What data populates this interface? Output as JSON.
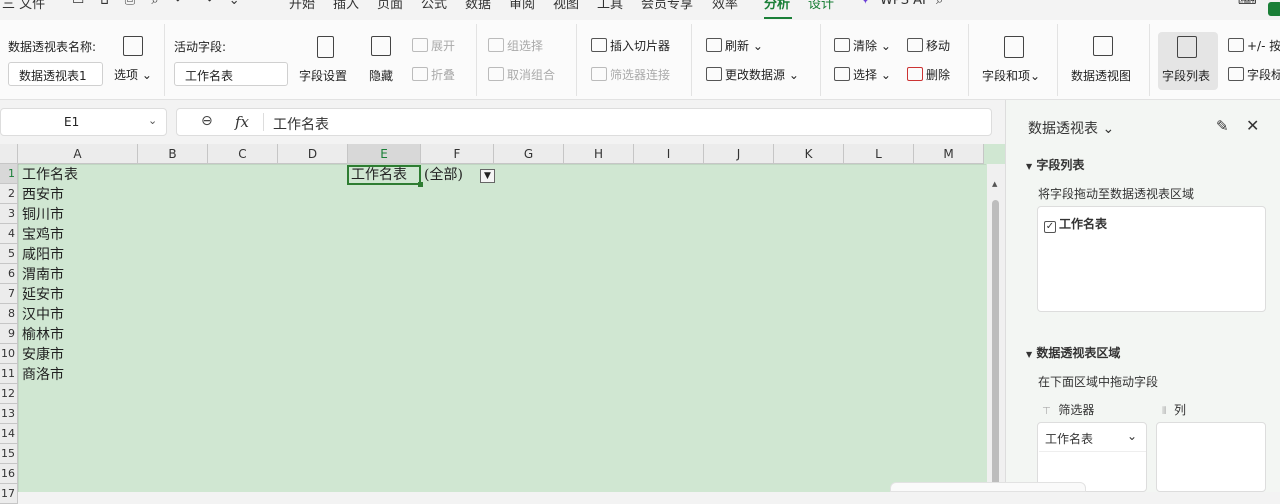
{
  "menu": {
    "tabs": [
      {
        "label": "三 文件"
      },
      {
        "label": "开始"
      },
      {
        "label": "插入"
      },
      {
        "label": "页面"
      },
      {
        "label": "公式"
      },
      {
        "label": "数据"
      },
      {
        "label": "审阅"
      },
      {
        "label": "视图"
      },
      {
        "label": "工具"
      },
      {
        "label": "会员专享"
      },
      {
        "label": "效率"
      },
      {
        "label": "分析"
      },
      {
        "label": "设计"
      },
      {
        "label": "WPS AI"
      }
    ]
  },
  "ribbon": {
    "pivot_name_label": "数据透视表名称:",
    "pivot_name_value": "数据透视表1",
    "options": "选项",
    "active_field_label": "活动字段:",
    "active_field_value": "工作名表",
    "field_settings": "字段设置",
    "hide": "隐藏",
    "expand": "展开",
    "collapse": "折叠",
    "group_select": "组选择",
    "ungroup": "取消组合",
    "insert_slicer": "插入切片器",
    "filter_connection": "筛选器连接",
    "refresh": "刷新",
    "change_source": "更改数据源",
    "clear": "清除",
    "select": "选择",
    "move": "移动",
    "delete": "删除",
    "fields_items": "字段和项",
    "pivot_chart": "数据透视图",
    "field_list": "字段列表",
    "plus_minus": "+/- 按",
    "field_header": "字段标"
  },
  "formula_bar": {
    "cell_ref": "E1",
    "fx": "fx",
    "content": "工作名表"
  },
  "sheet": {
    "columns": [
      "A",
      "B",
      "C",
      "D",
      "E",
      "F",
      "G",
      "H",
      "I",
      "J",
      "K",
      "L",
      "M"
    ],
    "rows": [
      "1",
      "2",
      "3",
      "4",
      "5",
      "6",
      "7",
      "8",
      "9",
      "10",
      "11",
      "12",
      "13",
      "14",
      "15",
      "16",
      "17"
    ],
    "colA": [
      "工作名表",
      "西安市",
      "铜川市",
      "宝鸡市",
      "咸阳市",
      "渭南市",
      "延安市",
      "汉中市",
      "榆林市",
      "安康市",
      "商洛市"
    ],
    "e1": "工作名表",
    "f1": "(全部)"
  },
  "panel": {
    "title": "数据透视表",
    "field_list_header": "字段列表",
    "drag_hint": "将字段拖动至数据透视表区域",
    "field_item": "工作名表",
    "area_header": "数据透视表区域",
    "area_hint": "在下面区域中拖动字段",
    "filter_label": "筛选器",
    "col_label": "列",
    "filter_value": "工作名表"
  }
}
